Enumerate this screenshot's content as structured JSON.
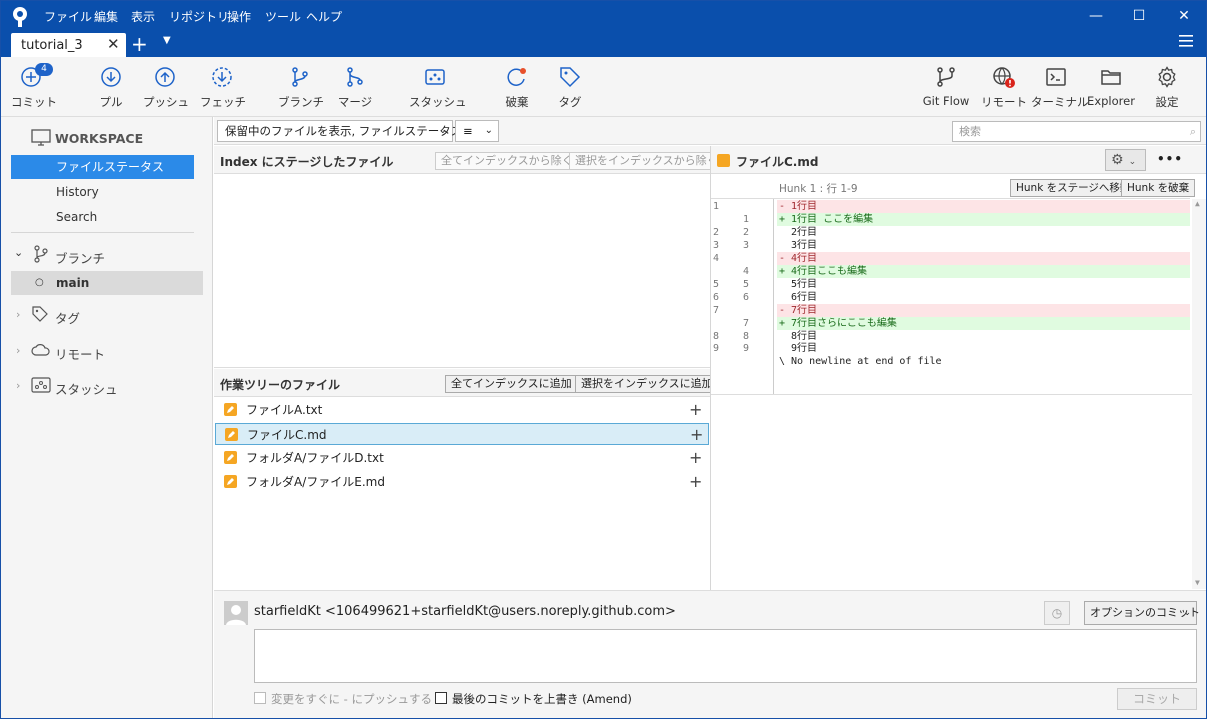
{
  "menu": [
    "ファイル",
    "編集",
    "表示",
    "リポジトリ",
    "操作",
    "ツール",
    "ヘルプ"
  ],
  "tab": {
    "label": "tutorial_3"
  },
  "toolbar": {
    "badge": "4",
    "buttons": [
      {
        "label": "コミット",
        "icon": "plus-circle-icon"
      },
      {
        "label": "プル",
        "icon": "arrow-down-circle-icon"
      },
      {
        "label": "プッシュ",
        "icon": "arrow-up-circle-icon"
      },
      {
        "label": "フェッチ",
        "icon": "fetch-icon"
      },
      {
        "label": "ブランチ",
        "icon": "branch-icon"
      },
      {
        "label": "マージ",
        "icon": "merge-icon"
      },
      {
        "label": "スタッシュ",
        "icon": "stash-icon"
      },
      {
        "label": "破棄",
        "icon": "discard-icon"
      },
      {
        "label": "タグ",
        "icon": "tag-icon"
      },
      {
        "label": "Git Flow",
        "icon": "git-flow-icon"
      },
      {
        "label": "リモート",
        "icon": "remote-globe-icon"
      },
      {
        "label": "ターミナル",
        "icon": "terminal-icon"
      },
      {
        "label": "Explorer",
        "icon": "folder-icon"
      },
      {
        "label": "設定",
        "icon": "gear-icon"
      }
    ]
  },
  "sidebar": {
    "workspace": "WORKSPACE",
    "workspace_items": [
      "ファイルステータス",
      "History",
      "Search"
    ],
    "branches": "ブランチ",
    "branch_items": [
      "main"
    ],
    "tags": "タグ",
    "remotes": "リモート",
    "stashes": "スタッシュ"
  },
  "filter": {
    "select": "保留中のファイルを表示, ファイルステータス順",
    "list_mode": "≡",
    "search_placeholder": "検索"
  },
  "staged": {
    "title": "Index にステージしたファイル",
    "remove_all": "全てインデックスから除く",
    "remove_selected": "選択をインデックスから除く"
  },
  "unstaged": {
    "title": "作業ツリーのファイル",
    "add_all": "全てインデックスに追加",
    "add_selected": "選択をインデックスに追加",
    "files": [
      "ファイルA.txt",
      "ファイルC.md",
      "フォルダA/ファイルD.txt",
      "フォルダA/ファイルE.md"
    ],
    "selected_index": 1
  },
  "diff": {
    "file": "ファイルC.md",
    "hunk": "Hunk 1 : 行 1-9",
    "stage_hunk": "Hunk をステージへ移動",
    "discard_hunk": "Hunk を破棄",
    "more": "•••",
    "lines": [
      {
        "type": "del",
        "old": "1",
        "new": "",
        "text": "- 1行目"
      },
      {
        "type": "add",
        "old": "",
        "new": "1",
        "text": "+ 1行目 ここを編集"
      },
      {
        "type": "ctx",
        "old": "2",
        "new": "2",
        "text": "  2行目"
      },
      {
        "type": "ctx",
        "old": "3",
        "new": "3",
        "text": "  3行目"
      },
      {
        "type": "del",
        "old": "4",
        "new": "",
        "text": "- 4行目"
      },
      {
        "type": "add",
        "old": "",
        "new": "4",
        "text": "+ 4行目ここも編集"
      },
      {
        "type": "ctx",
        "old": "5",
        "new": "5",
        "text": "  5行目"
      },
      {
        "type": "ctx",
        "old": "6",
        "new": "6",
        "text": "  6行目"
      },
      {
        "type": "del",
        "old": "7",
        "new": "",
        "text": "- 7行目"
      },
      {
        "type": "add",
        "old": "",
        "new": "7",
        "text": "+ 7行目さらにここも編集"
      },
      {
        "type": "ctx",
        "old": "8",
        "new": "8",
        "text": "  8行目"
      },
      {
        "type": "ctx",
        "old": "9",
        "new": "9",
        "text": "  9行目"
      },
      {
        "type": "ctx",
        "old": "",
        "new": "",
        "text": "\\ No newline at end of file"
      }
    ]
  },
  "commit": {
    "author": "starfieldKt <106499621+starfieldKt@users.noreply.github.com>",
    "options": "オプションのコミット",
    "push_immediately": "変更をすぐに - にプッシュする",
    "amend": "最後のコミットを上書き (Amend)",
    "commit_button": "コミット"
  }
}
